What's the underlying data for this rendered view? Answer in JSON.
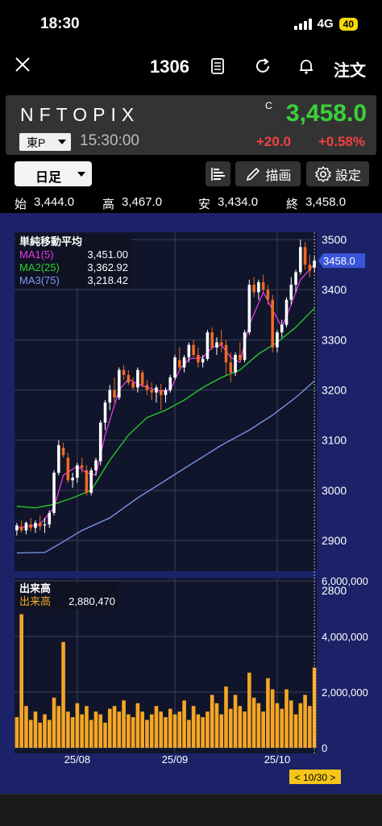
{
  "status": {
    "time": "18:30",
    "network": "4G",
    "battery": "40"
  },
  "nav": {
    "code": "1306",
    "order_label": "注文"
  },
  "ticker": {
    "name": "NFTOPIX",
    "c_mark": "C",
    "price": "3,458.0",
    "market": "東P",
    "time": "15:30:00",
    "change": "+20.0",
    "change_pct": "+0.58%"
  },
  "toolbar": {
    "period": "日足",
    "draw_label": "描画",
    "settings_label": "設定"
  },
  "ohlc": {
    "open_label": "始",
    "open": "3,444.0",
    "high_label": "高",
    "high": "3,467.0",
    "low_label": "安",
    "low": "3,434.0",
    "close_label": "終",
    "close": "3,458.0"
  },
  "legend_price": {
    "title": "単純移動平均",
    "items": [
      {
        "label": "MA1(5)",
        "value": "3,451.00",
        "color": "#e33be3"
      },
      {
        "label": "MA2(25)",
        "value": "3,362.92",
        "color": "#2ad12a"
      },
      {
        "label": "MA3(75)",
        "value": "3,218.42",
        "color": "#7d9cf0"
      }
    ]
  },
  "legend_volume": {
    "title": "出来高",
    "label": "出来高",
    "value": "2,880,470",
    "color": "#f5a623"
  },
  "colors": {
    "up": "#ffffff",
    "down": "#f06a22",
    "volume": "#f5a623",
    "ma1": "#e33be3",
    "ma2": "#2ad12a",
    "ma3": "#7d9cf0",
    "plot_bg": "#10152b",
    "frame_bg": "#1c2268",
    "grid": "#3a4158",
    "last_badge": "#3b55d8",
    "date_badge": "#f5c518"
  },
  "chart_data": [
    {
      "type": "candlestick",
      "ylim": [
        2800,
        3500
      ],
      "y_ticks": [
        "3500",
        "3400",
        "3300",
        "3200",
        "3100",
        "3000",
        "2900",
        "2800"
      ],
      "last_price_label": "3458.0",
      "x_ticks": [
        {
          "label": "25/08",
          "index": 13
        },
        {
          "label": "25/09",
          "index": 34
        },
        {
          "label": "25/10",
          "index": 56
        }
      ],
      "cursor_label": "< 10/30 >",
      "ohlc": [
        [
          2920,
          2935,
          2910,
          2930
        ],
        [
          2928,
          2940,
          2915,
          2920
        ],
        [
          2920,
          2938,
          2912,
          2935
        ],
        [
          2932,
          2945,
          2918,
          2925
        ],
        [
          2925,
          2940,
          2915,
          2935
        ],
        [
          2935,
          2950,
          2920,
          2928
        ],
        [
          2930,
          2945,
          2915,
          2932
        ],
        [
          2932,
          2960,
          2925,
          2955
        ],
        [
          2955,
          3040,
          2950,
          3035
        ],
        [
          3035,
          3100,
          3030,
          3090
        ],
        [
          3085,
          3095,
          3065,
          3070
        ],
        [
          3065,
          3075,
          3015,
          3020
        ],
        [
          3020,
          3035,
          3005,
          3025
        ],
        [
          3025,
          3055,
          3015,
          3050
        ],
        [
          3050,
          3065,
          3035,
          3045
        ],
        [
          3040,
          3050,
          2990,
          2995
        ],
        [
          2995,
          3045,
          2990,
          3040
        ],
        [
          3040,
          3065,
          3030,
          3060
        ],
        [
          3058,
          3140,
          3050,
          3135
        ],
        [
          3135,
          3180,
          3120,
          3175
        ],
        [
          3175,
          3210,
          3160,
          3200
        ],
        [
          3200,
          3225,
          3175,
          3185
        ],
        [
          3185,
          3245,
          3180,
          3240
        ],
        [
          3240,
          3250,
          3220,
          3230
        ],
        [
          3230,
          3240,
          3210,
          3215
        ],
        [
          3215,
          3225,
          3200,
          3205
        ],
        [
          3205,
          3245,
          3195,
          3240
        ],
        [
          3235,
          3240,
          3205,
          3210
        ],
        [
          3210,
          3220,
          3190,
          3200
        ],
        [
          3200,
          3215,
          3180,
          3195
        ],
        [
          3195,
          3210,
          3175,
          3205
        ],
        [
          3200,
          3212,
          3160,
          3190
        ],
        [
          3190,
          3205,
          3175,
          3200
        ],
        [
          3200,
          3230,
          3195,
          3225
        ],
        [
          3225,
          3270,
          3220,
          3265
        ],
        [
          3260,
          3285,
          3240,
          3245
        ],
        [
          3245,
          3270,
          3235,
          3265
        ],
        [
          3265,
          3295,
          3255,
          3290
        ],
        [
          3290,
          3300,
          3265,
          3270
        ],
        [
          3270,
          3285,
          3245,
          3255
        ],
        [
          3255,
          3270,
          3245,
          3262
        ],
        [
          3262,
          3320,
          3258,
          3315
        ],
        [
          3315,
          3325,
          3280,
          3285
        ],
        [
          3285,
          3305,
          3270,
          3295
        ],
        [
          3295,
          3320,
          3275,
          3290
        ],
        [
          3290,
          3300,
          3230,
          3255
        ],
        [
          3255,
          3275,
          3215,
          3235
        ],
        [
          3235,
          3275,
          3228,
          3270
        ],
        [
          3270,
          3295,
          3255,
          3260
        ],
        [
          3260,
          3320,
          3255,
          3315
        ],
        [
          3315,
          3420,
          3310,
          3410
        ],
        [
          3410,
          3425,
          3385,
          3395
        ],
        [
          3395,
          3420,
          3380,
          3415
        ],
        [
          3415,
          3430,
          3395,
          3400
        ],
        [
          3400,
          3410,
          3370,
          3380
        ],
        [
          3380,
          3390,
          3275,
          3285
        ],
        [
          3285,
          3320,
          3275,
          3315
        ],
        [
          3315,
          3340,
          3305,
          3330
        ],
        [
          3330,
          3385,
          3325,
          3380
        ],
        [
          3380,
          3425,
          3370,
          3410
        ],
        [
          3410,
          3440,
          3395,
          3435
        ],
        [
          3435,
          3500,
          3430,
          3485
        ],
        [
          3485,
          3495,
          3440,
          3450
        ],
        [
          3450,
          3470,
          3425,
          3438
        ],
        [
          3444,
          3467,
          3434,
          3458
        ]
      ],
      "ma": [
        {
          "name": "MA1(5)",
          "points": [
            [
              0,
              2925
            ],
            [
              5,
              2932
            ],
            [
              8,
              2965
            ],
            [
              10,
              3030
            ],
            [
              13,
              3048
            ],
            [
              15,
              3035
            ],
            [
              17,
              3030
            ],
            [
              19,
              3110
            ],
            [
              22,
              3200
            ],
            [
              24,
              3222
            ],
            [
              26,
              3212
            ],
            [
              28,
              3205
            ],
            [
              31,
              3198
            ],
            [
              33,
              3200
            ],
            [
              35,
              3240
            ],
            [
              37,
              3262
            ],
            [
              40,
              3265
            ],
            [
              42,
              3285
            ],
            [
              44,
              3290
            ],
            [
              46,
              3265
            ],
            [
              48,
              3255
            ],
            [
              50,
              3330
            ],
            [
              53,
              3395
            ],
            [
              55,
              3360
            ],
            [
              57,
              3325
            ],
            [
              59,
              3370
            ],
            [
              61,
              3420
            ],
            [
              63,
              3440
            ],
            [
              64,
              3451
            ]
          ]
        },
        {
          "name": "MA2(25)",
          "points": [
            [
              0,
              2968
            ],
            [
              4,
              2965
            ],
            [
              8,
              2972
            ],
            [
              12,
              2985
            ],
            [
              16,
              3000
            ],
            [
              20,
              3060
            ],
            [
              24,
              3110
            ],
            [
              28,
              3145
            ],
            [
              32,
              3160
            ],
            [
              36,
              3180
            ],
            [
              40,
              3205
            ],
            [
              44,
              3225
            ],
            [
              48,
              3240
            ],
            [
              52,
              3272
            ],
            [
              56,
              3295
            ],
            [
              60,
              3325
            ],
            [
              64,
              3363
            ]
          ]
        },
        {
          "name": "MA3(75)",
          "points": [
            [
              0,
              2875
            ],
            [
              6,
              2876
            ],
            [
              9,
              2892
            ],
            [
              14,
              2920
            ],
            [
              20,
              2945
            ],
            [
              26,
              2985
            ],
            [
              32,
              3020
            ],
            [
              38,
              3055
            ],
            [
              44,
              3090
            ],
            [
              50,
              3120
            ],
            [
              55,
              3150
            ],
            [
              60,
              3185
            ],
            [
              64,
              3218
            ]
          ]
        }
      ]
    },
    {
      "type": "bar",
      "ylim": [
        0,
        6000000
      ],
      "y_ticks": [
        "6,000,000",
        "4,000,000",
        "2,000,000",
        "0"
      ],
      "values": [
        1100000,
        4800000,
        1500000,
        1000000,
        1300000,
        900000,
        1200000,
        1000000,
        1800000,
        1500000,
        3800000,
        1300000,
        1100000,
        1600000,
        1200000,
        1500000,
        1000000,
        1300000,
        1200000,
        900000,
        1400000,
        1500000,
        1300000,
        1700000,
        1200000,
        1100000,
        1600000,
        1300000,
        1000000,
        1200000,
        1500000,
        1300000,
        1100000,
        1400000,
        1200000,
        1300000,
        1700000,
        1000000,
        1500000,
        1200000,
        1100000,
        1300000,
        1900000,
        1600000,
        1200000,
        2200000,
        1400000,
        1900000,
        1500000,
        1300000,
        2700000,
        1800000,
        1600000,
        1300000,
        2500000,
        2100000,
        1600000,
        1400000,
        2100000,
        1700000,
        1200000,
        1600000,
        1900000,
        1500000,
        2880470
      ]
    }
  ]
}
